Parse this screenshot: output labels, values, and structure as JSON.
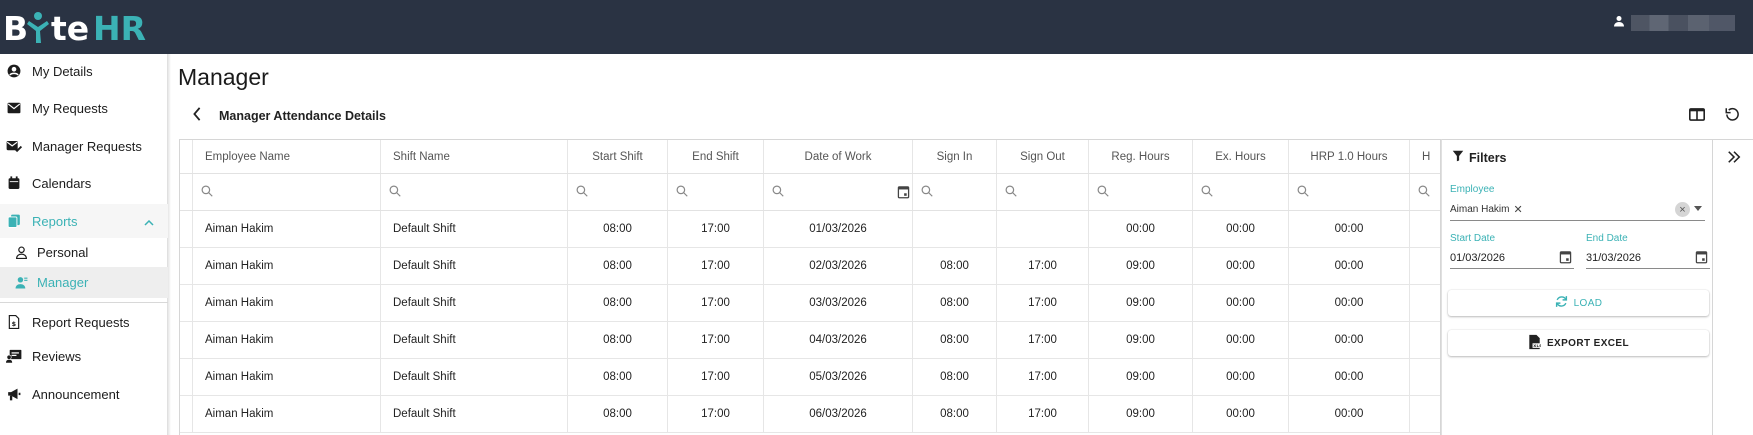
{
  "app": {
    "logo_text": "BYteHR",
    "colors": {
      "topbar": "#2a3343",
      "accent": "#3bb2b5",
      "text": "#212121"
    }
  },
  "sidebar": {
    "items": [
      {
        "label": "My Details",
        "icon": "account-circle-icon"
      },
      {
        "label": "My Requests",
        "icon": "envelope-icon"
      },
      {
        "label": "Manager Requests",
        "icon": "envelope-check-icon"
      },
      {
        "label": "Calendars",
        "icon": "calendar-icon"
      },
      {
        "label": "Reports",
        "icon": "files-icon",
        "expanded": true
      },
      {
        "label": "Personal",
        "icon": "person-outline-icon"
      },
      {
        "label": "Manager",
        "icon": "manager-icon",
        "active": true
      },
      {
        "label": "Report Requests",
        "icon": "document-dollar-icon"
      },
      {
        "label": "Reviews",
        "icon": "review-icon"
      },
      {
        "label": "Announcement",
        "icon": "megaphone-icon"
      }
    ]
  },
  "page": {
    "title": "Manager",
    "subtitle": "Manager Attendance Details"
  },
  "grid": {
    "columns": [
      "Employee Name",
      "Shift Name",
      "Start Shift",
      "End Shift",
      "Date of Work",
      "Sign In",
      "Sign Out",
      "Reg. Hours",
      "Ex. Hours",
      "HRP 1.0 Hours",
      "H"
    ],
    "rows": [
      [
        "Aiman Hakim",
        "Default Shift",
        "08:00",
        "17:00",
        "01/03/2026",
        "",
        "",
        "00:00",
        "00:00",
        "00:00",
        ""
      ],
      [
        "Aiman Hakim",
        "Default Shift",
        "08:00",
        "17:00",
        "02/03/2026",
        "08:00",
        "17:00",
        "09:00",
        "00:00",
        "00:00",
        ""
      ],
      [
        "Aiman Hakim",
        "Default Shift",
        "08:00",
        "17:00",
        "03/03/2026",
        "08:00",
        "17:00",
        "09:00",
        "00:00",
        "00:00",
        ""
      ],
      [
        "Aiman Hakim",
        "Default Shift",
        "08:00",
        "17:00",
        "04/03/2026",
        "08:00",
        "17:00",
        "09:00",
        "00:00",
        "00:00",
        ""
      ],
      [
        "Aiman Hakim",
        "Default Shift",
        "08:00",
        "17:00",
        "05/03/2026",
        "08:00",
        "17:00",
        "09:00",
        "00:00",
        "00:00",
        ""
      ],
      [
        "Aiman Hakim",
        "Default Shift",
        "08:00",
        "17:00",
        "06/03/2026",
        "08:00",
        "17:00",
        "09:00",
        "00:00",
        "00:00",
        ""
      ]
    ]
  },
  "filters": {
    "title": "Filters",
    "employee_label": "Employee",
    "employee_chip": "Aiman Hakim",
    "start_date_label": "Start Date",
    "start_date": "01/03/2026",
    "end_date_label": "End Date",
    "end_date": "31/03/2026",
    "load_label": "LOAD",
    "export_label": "EXPORT EXCEL"
  }
}
